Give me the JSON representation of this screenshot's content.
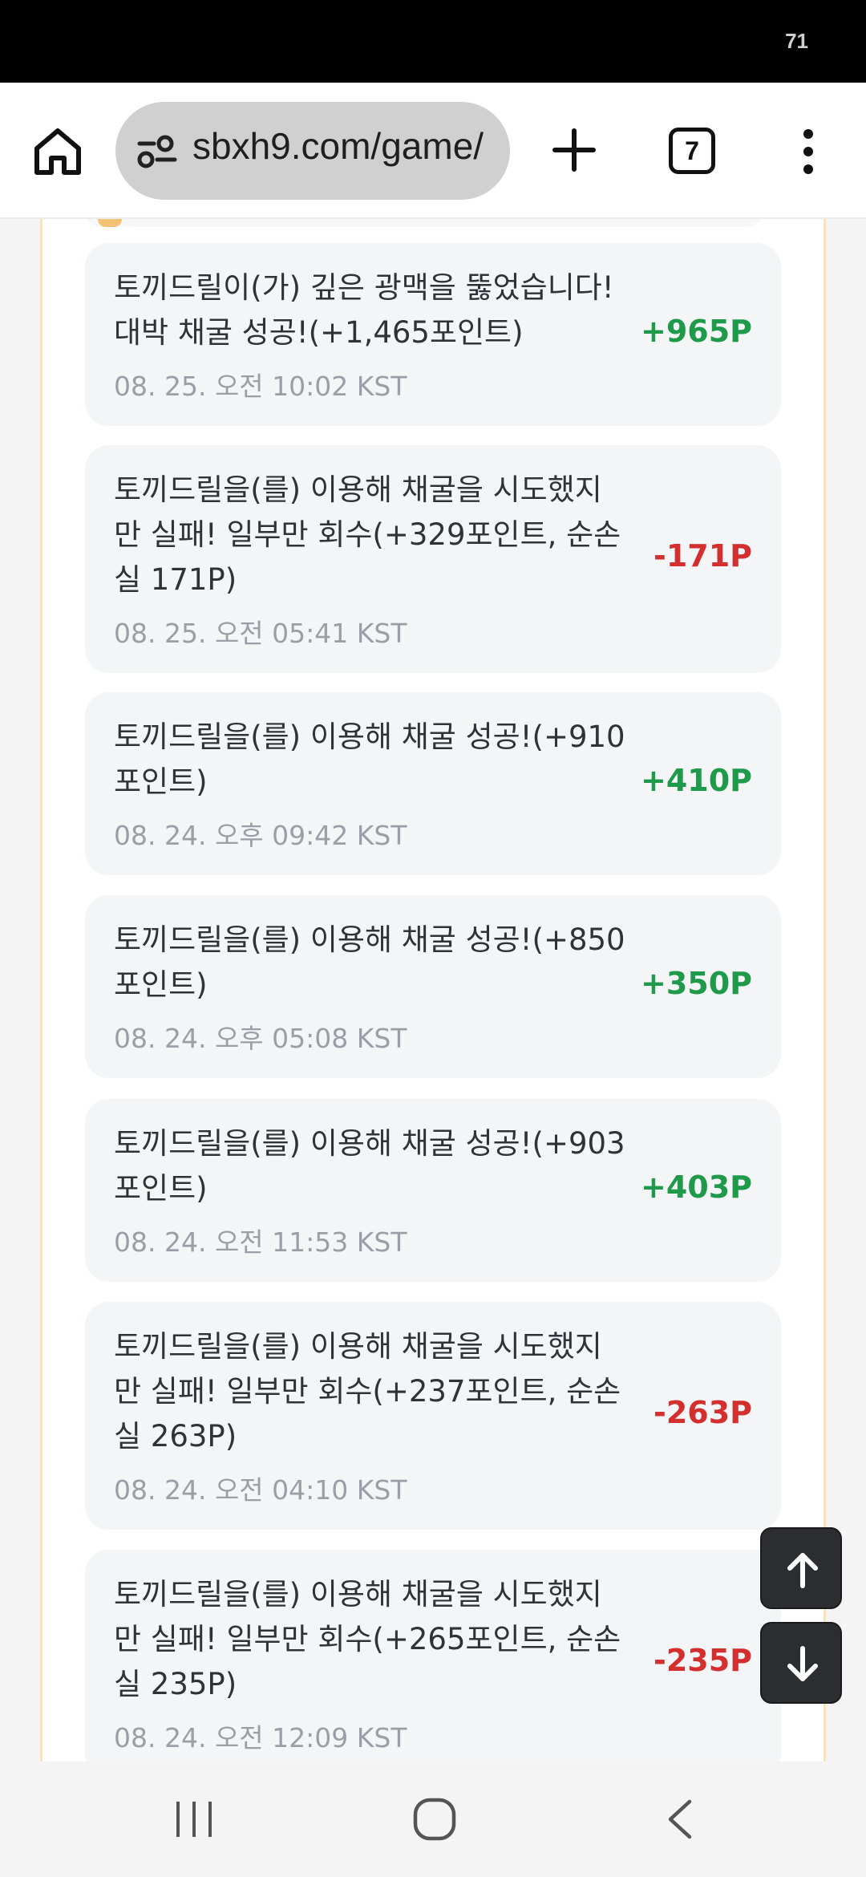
{
  "status_bar": {
    "battery": "71"
  },
  "browser": {
    "url": "sbxh9.com/game/",
    "tab_count": "7"
  },
  "records": [
    {
      "message": "토끼드릴이(가) 깊은 광맥을 뚫었습니다! 대박 채굴 성공!(+1,465포인트)",
      "time": "08. 25. 오전 10:02 KST",
      "amount": "+965P",
      "positive": true
    },
    {
      "message": "토끼드릴을(를) 이용해 채굴을 시도했지만 실패! 일부만 회수(+329포인트, 순손실 171P)",
      "time": "08. 25. 오전 05:41 KST",
      "amount": "-171P",
      "positive": false
    },
    {
      "message": "토끼드릴을(를) 이용해 채굴 성공!(+910포인트)",
      "time": "08. 24. 오후 09:42 KST",
      "amount": "+410P",
      "positive": true
    },
    {
      "message": "토끼드릴을(를) 이용해 채굴 성공!(+850포인트)",
      "time": "08. 24. 오후 05:08 KST",
      "amount": "+350P",
      "positive": true
    },
    {
      "message": "토끼드릴을(를) 이용해 채굴 성공!(+903포인트)",
      "time": "08. 24. 오전 11:53 KST",
      "amount": "+403P",
      "positive": true
    },
    {
      "message": "토끼드릴을(를) 이용해 채굴을 시도했지만 실패! 일부만 회수(+237포인트, 순손실 263P)",
      "time": "08. 24. 오전 04:10 KST",
      "amount": "-263P",
      "positive": false
    },
    {
      "message": "토끼드릴을(를) 이용해 채굴을 시도했지만 실패! 일부만 회수(+265포인트, 순손실 235P)",
      "time": "08. 24. 오전 12:09 KST",
      "amount": "-235P",
      "positive": false
    }
  ],
  "icons": {
    "home": "home-icon",
    "site_info": "tune-icon",
    "new_tab": "plus-icon",
    "menu": "more-vert-icon",
    "scroll_up": "arrow-up-icon",
    "scroll_down": "arrow-down-icon",
    "nav_recents": "recents-icon",
    "nav_home": "circle-home-icon",
    "nav_back": "back-chevron-icon"
  },
  "colors": {
    "positive": "#1e9a4a",
    "negative": "#d32f2f",
    "panel_border": "#fbe3b7"
  }
}
